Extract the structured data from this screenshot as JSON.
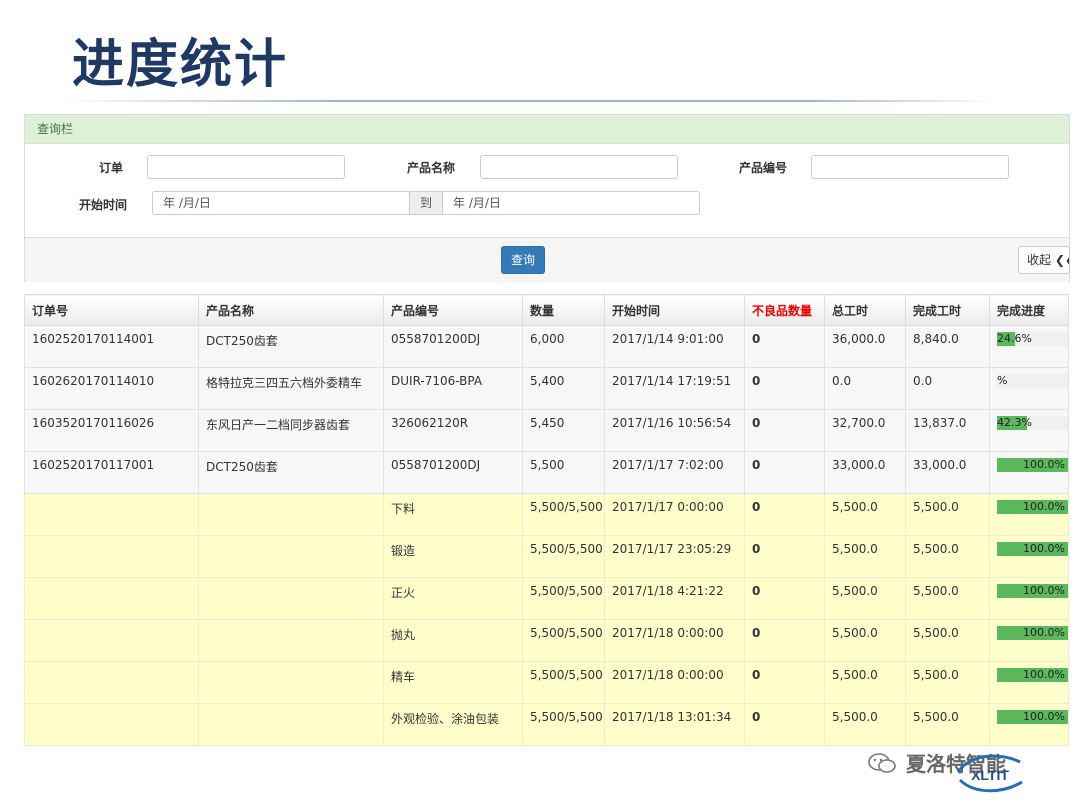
{
  "slide": {
    "title": "进度统计"
  },
  "query_panel": {
    "header": "查询栏",
    "order_label": "订单",
    "order_value": "",
    "product_name_label": "产品名称",
    "product_name_value": "",
    "product_code_label": "产品编号",
    "product_code_value": "",
    "start_time_label": "开始时间",
    "date_from_placeholder": "年 /月/日",
    "to_label": "到",
    "date_to_placeholder": "年 /月/日",
    "query_button": "查询",
    "collapse_button": "收起 ❮❮"
  },
  "table": {
    "columns": [
      "订单号",
      "产品名称",
      "产品编号",
      "数量",
      "开始时间",
      "不良品数量",
      "总工时",
      "完成工时",
      "完成进度"
    ],
    "orders": [
      {
        "order": "1602520170114001",
        "name": "DCT250齿套",
        "code": "0558701200DJ",
        "qty": "6,000",
        "start": "2017/1/14 9:01:00",
        "defect": "0",
        "total": "36,000.0",
        "done": "8,840.0",
        "progress_label": "24.6%",
        "progress": 0.246
      },
      {
        "order": "1602620170114010",
        "name": "格特拉克三四五六档外委精车",
        "code": "DUIR-7106-BPA",
        "qty": "5,400",
        "start": "2017/1/14 17:19:51",
        "defect": "0",
        "total": "0.0",
        "done": "0.0",
        "progress_label": "%",
        "progress": 0
      },
      {
        "order": "1603520170116026",
        "name": "东风日产一二档同步器齿套",
        "code": "326062120R",
        "qty": "5,450",
        "start": "2017/1/16 10:56:54",
        "defect": "0",
        "total": "32,700.0",
        "done": "13,837.0",
        "progress_label": "42.3%",
        "progress": 0.423
      },
      {
        "order": "1602520170117001",
        "name": "DCT250齿套",
        "code": "0558701200DJ",
        "qty": "5,500",
        "start": "2017/1/17 7:02:00",
        "defect": "0",
        "total": "33,000.0",
        "done": "33,000.0",
        "progress_label": "100.0%",
        "progress": 1.0
      }
    ],
    "processes": [
      {
        "step": "下料",
        "qty": "5,500/5,500",
        "start": "2017/1/17 0:00:00",
        "defect": "0",
        "total": "5,500.0",
        "done": "5,500.0",
        "progress_label": "100.0%",
        "progress": 1.0
      },
      {
        "step": "锻造",
        "qty": "5,500/5,500",
        "start": "2017/1/17 23:05:29",
        "defect": "0",
        "total": "5,500.0",
        "done": "5,500.0",
        "progress_label": "100.0%",
        "progress": 1.0
      },
      {
        "step": "正火",
        "qty": "5,500/5,500",
        "start": "2017/1/18 4:21:22",
        "defect": "0",
        "total": "5,500.0",
        "done": "5,500.0",
        "progress_label": "100.0%",
        "progress": 1.0
      },
      {
        "step": "抛丸",
        "qty": "5,500/5,500",
        "start": "2017/1/18 0:00:00",
        "defect": "0",
        "total": "5,500.0",
        "done": "5,500.0",
        "progress_label": "100.0%",
        "progress": 1.0
      },
      {
        "step": "精车",
        "qty": "5,500/5,500",
        "start": "2017/1/18 0:00:00",
        "defect": "0",
        "total": "5,500.0",
        "done": "5,500.0",
        "progress_label": "100.0%",
        "progress": 1.0
      },
      {
        "step": "外观检验、涂油包装",
        "qty": "5,500/5,500",
        "start": "2017/1/18 13:01:34",
        "defect": "0",
        "total": "5,500.0",
        "done": "5,500.0",
        "progress_label": "100.0%",
        "progress": 1.0
      }
    ]
  },
  "watermark": {
    "text": "夏洛特智能",
    "logo_text": "XLTIT",
    "icon": "wechat-icon"
  },
  "colors": {
    "title": "#1f3864",
    "panel_header_bg": "#dff0d8",
    "primary_button": "#337ab7",
    "progress": "#5cb85c",
    "process_row": "#ffffcc",
    "defect": "#e00000"
  }
}
